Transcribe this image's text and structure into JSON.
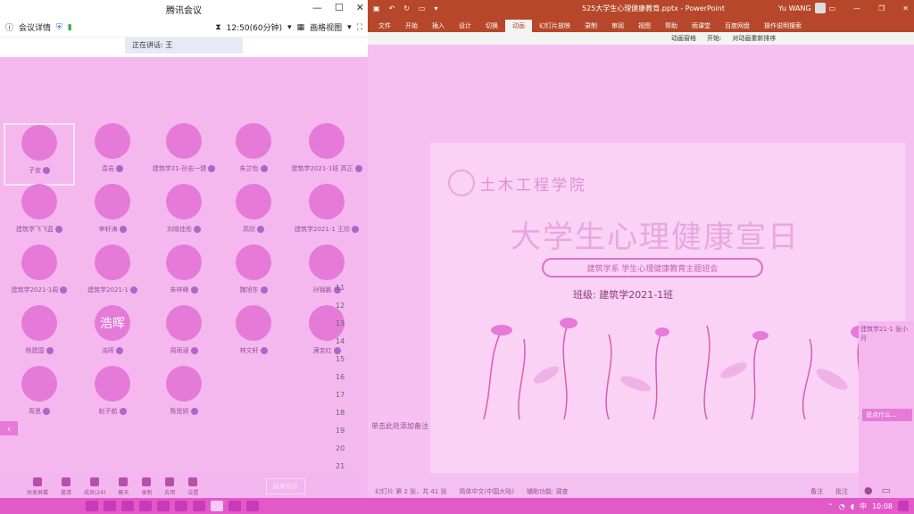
{
  "meeting": {
    "window_title": "腾讯会议",
    "toolbar": {
      "info_label": "会议详情",
      "timer": "12:50(60分钟)",
      "view_label": "画格视图"
    },
    "speaking_label": "正在讲话: 王",
    "participants": [
      {
        "name": "子宣"
      },
      {
        "name": "袁岩"
      },
      {
        "name": "建筑学21-孙志一健"
      },
      {
        "name": "朱芷怡"
      },
      {
        "name": "建筑学2021-1班 高正"
      },
      {
        "name": "建筑学飞飞蓝"
      },
      {
        "name": "李轩涛"
      },
      {
        "name": "刘晓佳彤"
      },
      {
        "name": "高欣"
      },
      {
        "name": "建筑学2021-1 王欣"
      },
      {
        "name": "建筑学2021-1周"
      },
      {
        "name": "建筑学2021-1"
      },
      {
        "name": "朱梓峰"
      },
      {
        "name": "魏旭东"
      },
      {
        "name": "孙锦鹏"
      },
      {
        "name": "杨建国"
      },
      {
        "name": "浩晖",
        "avatar_text": "浩晖"
      },
      {
        "name": "周雨涵"
      },
      {
        "name": "林文轩"
      },
      {
        "name": "满宝红"
      },
      {
        "name": "周思"
      },
      {
        "name": "赵子航"
      },
      {
        "name": "陈思妍"
      }
    ],
    "bottom_bar": [
      {
        "label": "共享屏幕",
        "icon": "share-screen-icon"
      },
      {
        "label": "邀请",
        "icon": "invite-icon"
      },
      {
        "label": "成员(24)",
        "icon": "members-icon"
      },
      {
        "label": "聊天",
        "icon": "chat-icon"
      },
      {
        "label": "录制",
        "icon": "record-icon"
      },
      {
        "label": "应用",
        "icon": "apps-icon"
      },
      {
        "label": "设置",
        "icon": "settings-icon"
      }
    ],
    "end_label": "结束会议"
  },
  "ppt": {
    "window_title": "525大学生心理健康教育.pptx - PowerPoint",
    "user_name": "Yu WANG",
    "tabs": [
      "文件",
      "开始",
      "插入",
      "设计",
      "切换",
      "动画",
      "幻灯片放映",
      "录制",
      "审阅",
      "视图",
      "帮助",
      "雨课堂",
      "百度网盘",
      "操作说明搜索"
    ],
    "active_tab": "动画",
    "ribbon": {
      "animation_pane": "动画窗格",
      "start": "开始:",
      "reorder": "对动画重新排序"
    },
    "slide": {
      "school": "土木工程学院",
      "title": "大学生心理健康宣日",
      "subtitle": "建筑学系 学生心理健康教育主题班会",
      "class_line": "班级: 建筑学2021-1班"
    },
    "row_numbers": [
      "11",
      "12",
      "13",
      "14",
      "15",
      "16",
      "17",
      "18",
      "19",
      "20",
      "21"
    ],
    "notes_placeholder": "单击此处添加备注",
    "status": {
      "slide_info": "幻灯片 第 2 张，共 41 张",
      "language": "简体中文(中国大陆)",
      "accessibility": "辅助功能: 调查",
      "notes": "备注",
      "comments": "批注"
    }
  },
  "chat_side": {
    "pill_label": "说点什么...",
    "banner": "建筑学21-1 张小月"
  },
  "taskbar": {
    "ime": "中",
    "time": "10:08"
  }
}
